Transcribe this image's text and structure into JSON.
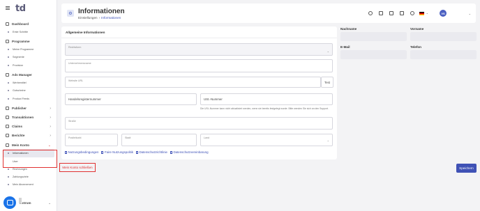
{
  "sidebar": {
    "logo": "td",
    "sections": [
      {
        "label": "Dashboard",
        "items": [
          "Erste Schritte"
        ]
      },
      {
        "label": "Programme",
        "items": [
          "Meine Programme",
          "Segmente",
          "Provision"
        ]
      },
      {
        "label": "Ads Manager",
        "items": [
          "Werbemittel",
          "Gutscheine",
          "Product Feeds"
        ]
      }
    ],
    "collapsed": [
      {
        "label": "Publisher",
        "chev": "›"
      },
      {
        "label": "Transaktionen",
        "chev": "›"
      },
      {
        "label": "Claims",
        "chev": "›"
      },
      {
        "label": "Berichte",
        "chev": "›"
      }
    ],
    "account": {
      "label": "Mein Konto",
      "chev": "⌄",
      "active": "Informationen",
      "items": [
        "User",
        "Rechnungen",
        "Zahlungsziele",
        "Mein Abonnement"
      ]
    },
    "bottom": {
      "label": "...ntrum",
      "chev": "⌄"
    }
  },
  "header": {
    "title": "Informationen",
    "breadcrumb": [
      "Einstellungen",
      "Informationen"
    ],
    "breadcrumb_sep": "›",
    "avatar": "VS",
    "chev": "⌄"
  },
  "form": {
    "section_title": "Allgemeine Informationen",
    "rechtsform": "Rechtsform",
    "unternehmensname": "Unternehmensname",
    "website": "Website URL",
    "test": "Test",
    "handelsregister": "Handelsregisternummer",
    "ust": "USt.-Nummer",
    "ust_help": "Die USt.-Nummer kann nicht aktualisiert werden, wenn sie bereits festgelegt wurde. Bitte wenden Sie sich an den Support.",
    "strasse": "Straße",
    "plz": "Postleitzahl",
    "stadt": "Stadt",
    "land": "Land",
    "chev": "⌄"
  },
  "links": [
    "Nutzungsbedingungen",
    "Faire Nutzungspolitik",
    "Datenschutzrichtlinie",
    "Datenschutzvereinbarung"
  ],
  "contact": {
    "nachname": "Nachname",
    "vorname": "Vorname",
    "email": "E-Mail",
    "telefon": "Telefon"
  },
  "actions": {
    "close_account": "Mein Konto schließen",
    "save": "Speichern"
  },
  "colors": {
    "accent": "#3f51b5",
    "highlight": "#e03131"
  }
}
